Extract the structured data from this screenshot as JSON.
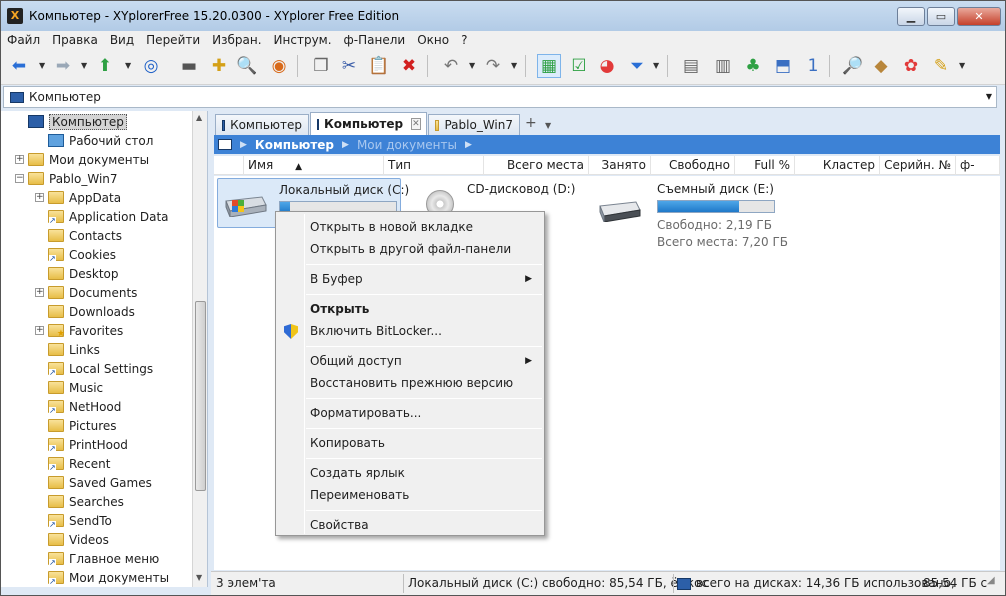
{
  "window": {
    "title": "Компьютер - XYplorerFree 15.20.0300 - XYplorer Free Edition",
    "controls": {
      "minimize": "▁",
      "maximize": "▭",
      "close": "✕"
    }
  },
  "menubar": [
    "Файл",
    "Правка",
    "Вид",
    "Перейти",
    "Избран.",
    "Инструм.",
    "ф-Панели",
    "Окно",
    "?"
  ],
  "toolbar": {
    "buttons": [
      {
        "name": "back-icon",
        "glyph": "⬅",
        "color": "#2a6fd6"
      },
      {
        "name": "forward-icon",
        "glyph": "➡",
        "color": "#9aa8b7"
      },
      {
        "name": "up-icon",
        "glyph": "⬆",
        "color": "#2ea043"
      },
      {
        "name": "target-icon",
        "glyph": "◎",
        "color": "#1c5fc7"
      },
      {
        "name": "drive-icon",
        "glyph": "▬",
        "color": "#555555"
      },
      {
        "name": "new-folder-icon",
        "glyph": "✚",
        "color": "#d4a017"
      },
      {
        "name": "find-icon",
        "glyph": "🔍",
        "color": "#555555"
      },
      {
        "name": "history-icon",
        "glyph": "◉",
        "color": "#d86a1a"
      },
      {
        "name": "copy-icon",
        "glyph": "❐",
        "color": "#666666"
      },
      {
        "name": "cut-icon",
        "glyph": "✂",
        "color": "#3a5da8"
      },
      {
        "name": "paste-icon",
        "glyph": "📋",
        "color": "#8a6a3a"
      },
      {
        "name": "delete-icon",
        "glyph": "✖",
        "color": "#d22020"
      },
      {
        "name": "undo-icon",
        "glyph": "↶",
        "color": "#777777"
      },
      {
        "name": "redo-icon",
        "glyph": "↷",
        "color": "#777777"
      },
      {
        "name": "tree-view-icon",
        "glyph": "▦",
        "color": "#2ea043"
      },
      {
        "name": "checkbox-icon",
        "glyph": "☑",
        "color": "#2ea043"
      },
      {
        "name": "chart-icon",
        "glyph": "◕",
        "color": "#e23a3a"
      },
      {
        "name": "filter-icon",
        "glyph": "⏷",
        "color": "#2a6fd6"
      },
      {
        "name": "layout-icon",
        "glyph": "▤",
        "color": "#666666"
      },
      {
        "name": "details-icon",
        "glyph": "▥",
        "color": "#666666"
      },
      {
        "name": "branch-icon",
        "glyph": "♣",
        "color": "#2ea043"
      },
      {
        "name": "split-icon",
        "glyph": "⬒",
        "color": "#3a6fc2"
      },
      {
        "name": "single-pane-icon",
        "glyph": "1",
        "color": "#3a6fc2"
      },
      {
        "name": "search-icon",
        "glyph": "🔎",
        "color": "#2a6fd6"
      },
      {
        "name": "tag-icon",
        "glyph": "◆",
        "color": "#b8863b"
      },
      {
        "name": "color-icon",
        "glyph": "✿",
        "color": "#e23a3a"
      },
      {
        "name": "brush-icon",
        "glyph": "✎",
        "color": "#d4a017"
      }
    ]
  },
  "address": {
    "value": "Компьютер"
  },
  "tree": {
    "items": [
      {
        "label": "Компьютер",
        "indent": 0,
        "icon": "computer",
        "expander": "",
        "selected": true
      },
      {
        "label": "Рабочий стол",
        "indent": 1,
        "icon": "desktop",
        "expander": ""
      },
      {
        "label": "Мои документы",
        "indent": 0,
        "icon": "folder",
        "expander": "+"
      },
      {
        "label": "Pablo_Win7",
        "indent": 0,
        "icon": "folder",
        "expander": "−"
      },
      {
        "label": "AppData",
        "indent": 1,
        "icon": "folder",
        "expander": "+"
      },
      {
        "label": "Application Data",
        "indent": 1,
        "icon": "link",
        "expander": ""
      },
      {
        "label": "Contacts",
        "indent": 1,
        "icon": "folder",
        "expander": ""
      },
      {
        "label": "Cookies",
        "indent": 1,
        "icon": "link",
        "expander": ""
      },
      {
        "label": "Desktop",
        "indent": 1,
        "icon": "folder",
        "expander": ""
      },
      {
        "label": "Documents",
        "indent": 1,
        "icon": "folder",
        "expander": "+"
      },
      {
        "label": "Downloads",
        "indent": 1,
        "icon": "folder",
        "expander": ""
      },
      {
        "label": "Favorites",
        "indent": 1,
        "icon": "star",
        "expander": "+"
      },
      {
        "label": "Links",
        "indent": 1,
        "icon": "folder",
        "expander": ""
      },
      {
        "label": "Local Settings",
        "indent": 1,
        "icon": "link",
        "expander": ""
      },
      {
        "label": "Music",
        "indent": 1,
        "icon": "folder",
        "expander": ""
      },
      {
        "label": "NetHood",
        "indent": 1,
        "icon": "link",
        "expander": ""
      },
      {
        "label": "Pictures",
        "indent": 1,
        "icon": "folder",
        "expander": ""
      },
      {
        "label": "PrintHood",
        "indent": 1,
        "icon": "link",
        "expander": ""
      },
      {
        "label": "Recent",
        "indent": 1,
        "icon": "link",
        "expander": ""
      },
      {
        "label": "Saved Games",
        "indent": 1,
        "icon": "folder",
        "expander": ""
      },
      {
        "label": "Searches",
        "indent": 1,
        "icon": "folder",
        "expander": ""
      },
      {
        "label": "SendTo",
        "indent": 1,
        "icon": "link",
        "expander": ""
      },
      {
        "label": "Videos",
        "indent": 1,
        "icon": "folder",
        "expander": ""
      },
      {
        "label": "Главное меню",
        "indent": 1,
        "icon": "link",
        "expander": ""
      },
      {
        "label": "Мои документы",
        "indent": 1,
        "icon": "link",
        "expander": ""
      }
    ]
  },
  "tabs": [
    {
      "label": "Компьютер",
      "icon": "computer"
    },
    {
      "label": "Компьютер",
      "icon": "computer",
      "active": true
    },
    {
      "label": "Pablo_Win7",
      "icon": "folder"
    }
  ],
  "breadcrumb": {
    "root": "Компьютер",
    "child": "Мои документы"
  },
  "columns": [
    "Имя",
    "Тип",
    "Всего места",
    "Занято",
    "Свободно",
    "Full %",
    "Кластер",
    "Серийн. №",
    "ф-Сист"
  ],
  "drives": [
    {
      "name": "Локальный диск (C:)",
      "fill": 0.09
    },
    {
      "name": "CD-дисковод (D:)"
    },
    {
      "name": "Съемный диск (E:)",
      "fill": 0.7,
      "free": "Свободно: 2,19 ГБ",
      "total": "Всего места: 7,20 ГБ"
    }
  ],
  "context_menu": {
    "items": [
      "Открыть в новой вкладке",
      "Открыть в другой файл-панели",
      "В Буфер",
      "Открыть",
      "Включить BitLocker...",
      "Общий доступ",
      "Восстановить прежнюю версию",
      "Форматировать...",
      "Копировать",
      "Создать ярлык",
      "Переименовать",
      "Свойства"
    ]
  },
  "status": {
    "count": "3 элем'та",
    "drive": "Локальный диск (C:)  свободно: 85,54 ГБ, ёмкос",
    "disks": "всего на дисках: 14,36 ГБ использовано,",
    "free": "85,54 ГБ с"
  }
}
